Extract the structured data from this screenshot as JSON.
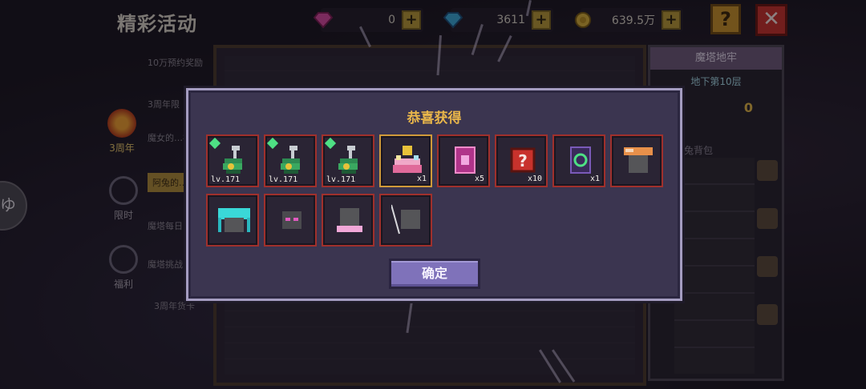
{
  "header": {
    "title": "精彩活动",
    "currencies": [
      {
        "icon": "pink-gem-icon",
        "value": "0",
        "color": "#d84aa0"
      },
      {
        "icon": "blue-diamond-icon",
        "value": "3611",
        "color": "#3aa8d8"
      },
      {
        "icon": "gold-coin-icon",
        "value": "639.5万",
        "color": "#d8b03a"
      }
    ],
    "help_label": "?",
    "close_label": "✕"
  },
  "sidebar": {
    "events": [
      "10万预约奖励",
      "3周年限",
      "魔女的…祝…",
      "阿兔的…历险…",
      "魔塔每日",
      "魔塔挑战",
      "3周年货卡"
    ],
    "tabs": [
      {
        "label": "3周年",
        "icon": "flame-icon"
      },
      {
        "label": "限时",
        "icon": "clock-icon"
      },
      {
        "label": "福利",
        "icon": "gift-icon"
      }
    ],
    "float_label": "ゆ"
  },
  "dungeon": {
    "title": "魔塔地牢",
    "floor": "地下第10层",
    "count": "0",
    "bag_label": "阿兔背包"
  },
  "dialog": {
    "title": "恭喜获得",
    "confirm_label": "确定",
    "rewards": [
      {
        "name": "snake-staff",
        "label": "lv.171",
        "gem": true,
        "frame": "red"
      },
      {
        "name": "snake-staff",
        "label": "lv.171",
        "gem": true,
        "frame": "red"
      },
      {
        "name": "snake-staff",
        "label": "lv.171",
        "gem": true,
        "frame": "red"
      },
      {
        "name": "anniversary-cake",
        "label": "x1",
        "gem": false,
        "frame": "gold"
      },
      {
        "name": "pink-card",
        "label": "x5",
        "gem": false,
        "frame": "red"
      },
      {
        "name": "mystery-box",
        "label": "x10",
        "gem": false,
        "frame": "red"
      },
      {
        "name": "green-rune-card",
        "label": "x1",
        "gem": false,
        "frame": "red"
      },
      {
        "name": "orange-hat",
        "label": "",
        "gem": false,
        "frame": "red"
      },
      {
        "name": "cyan-twintail-hair",
        "label": "",
        "gem": false,
        "frame": "red"
      },
      {
        "name": "dark-helmet-pink-eyes",
        "label": "",
        "gem": false,
        "frame": "red"
      },
      {
        "name": "helmet-pink-bow",
        "label": "",
        "gem": false,
        "frame": "red"
      },
      {
        "name": "helmet-with-pole",
        "label": "",
        "gem": false,
        "frame": "red"
      }
    ]
  }
}
